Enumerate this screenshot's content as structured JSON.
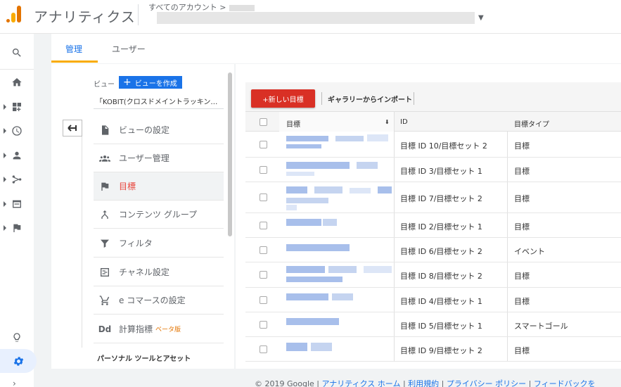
{
  "header": {
    "app_title": "アナリティクス",
    "account_crumb": "すべてのアカウント >"
  },
  "tabs": [
    {
      "label": "管理",
      "active": true
    },
    {
      "label": "ユーザー",
      "active": false
    }
  ],
  "view_column": {
    "label": "ビュー",
    "create_label": "ビューを作成",
    "view_name": "「KOBIT(クロスドメイントラッキング…",
    "items": [
      {
        "label": "ビューの設定",
        "icon": "document-icon"
      },
      {
        "label": "ユーザー管理",
        "icon": "people-icon"
      },
      {
        "label": "目標",
        "icon": "flag-icon",
        "active": true
      },
      {
        "label": "コンテンツ グループ",
        "icon": "content-group-icon"
      },
      {
        "label": "フィルタ",
        "icon": "filter-icon"
      },
      {
        "label": "チャネル設定",
        "icon": "channel-icon"
      },
      {
        "label": "e コマースの設定",
        "icon": "cart-icon"
      },
      {
        "label": "計算指標",
        "icon": "dd-icon",
        "badge": "ベータ版"
      }
    ],
    "section_heading": "パーソナル ツールとアセット"
  },
  "toolbar": {
    "new_goal": "+新しい目標",
    "import": "ギャラリーからインポート"
  },
  "table": {
    "headers": {
      "goal": "目標",
      "id": "ID",
      "type": "目標タイプ"
    },
    "rows": [
      {
        "id": "目標 ID 10/目標セット 2",
        "type": "目標"
      },
      {
        "id": "目標 ID 3/目標セット 1",
        "type": "目標"
      },
      {
        "id": "目標 ID 7/目標セット 2",
        "type": "目標"
      },
      {
        "id": "目標 ID 2/目標セット 1",
        "type": "目標"
      },
      {
        "id": "目標 ID 6/目標セット 2",
        "type": "イベント"
      },
      {
        "id": "目標 ID 8/目標セット 2",
        "type": "目標"
      },
      {
        "id": "目標 ID 4/目標セット 1",
        "type": "目標"
      },
      {
        "id": "目標 ID 5/目標セット 1",
        "type": "スマートゴール"
      },
      {
        "id": "目標 ID 9/目標セット 2",
        "type": "目標"
      }
    ]
  },
  "footer": {
    "copyright": "© 2019 Google",
    "links": [
      "アナリティクス ホーム",
      "利用規約",
      "プライバシー ポリシー",
      "フィードバックを"
    ]
  },
  "colors": {
    "accent": "#1a73e8",
    "active_item": "#e8453c",
    "new_goal_button": "#d93025",
    "tab_underline": "#f9ab00"
  }
}
